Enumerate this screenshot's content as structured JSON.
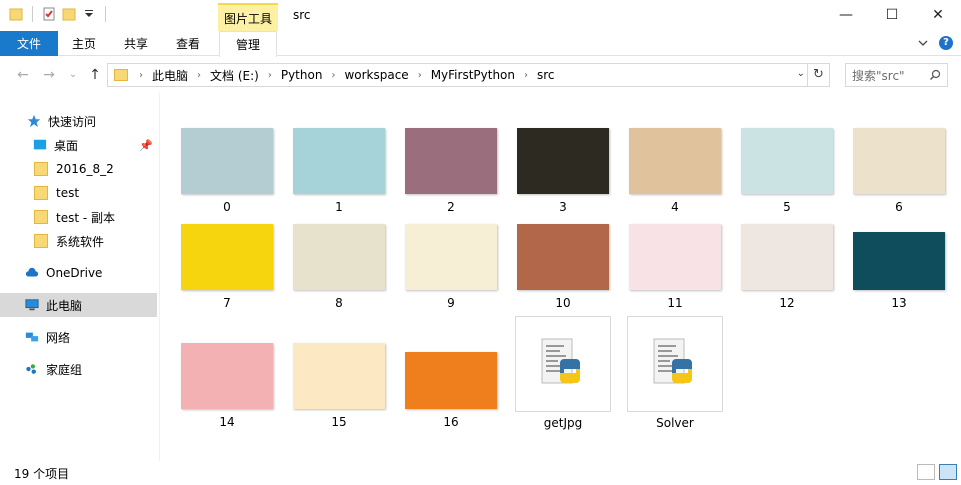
{
  "window": {
    "context_tab_header": "图片工具",
    "title": "src",
    "controls": [
      "—",
      "☐",
      "✕"
    ]
  },
  "ribbon": {
    "tabs": [
      "文件",
      "主页",
      "共享",
      "查看",
      "管理"
    ]
  },
  "address": {
    "crumbs": [
      "此电脑",
      "文档 (E:)",
      "Python",
      "workspace",
      "MyFirstPython",
      "src"
    ],
    "search_placeholder": "搜索\"src\""
  },
  "sidebar": {
    "items": [
      {
        "label": "快速访问",
        "icon": "star-icon"
      },
      {
        "label": "桌面",
        "icon": "desktop-icon",
        "pinned": true
      },
      {
        "label": "2016_8_2",
        "icon": "folder-icon"
      },
      {
        "label": "test",
        "icon": "folder-icon"
      },
      {
        "label": "test - 副本",
        "icon": "folder-icon"
      },
      {
        "label": "系统软件",
        "icon": "folder-icon"
      },
      {
        "label": "OneDrive",
        "icon": "cloud-icon"
      },
      {
        "label": "此电脑",
        "icon": "computer-icon",
        "selected": true
      },
      {
        "label": "网络",
        "icon": "network-icon"
      },
      {
        "label": "家庭组",
        "icon": "homegroup-icon"
      }
    ]
  },
  "files": [
    {
      "name": "0",
      "bg": "#b3cdd2"
    },
    {
      "name": "1",
      "bg": "#a5d3d9"
    },
    {
      "name": "2",
      "bg": "#9a6e7c"
    },
    {
      "name": "3",
      "bg": "#2d2a22"
    },
    {
      "name": "4",
      "bg": "#e0c29c"
    },
    {
      "name": "5",
      "bg": "#cbe3e3"
    },
    {
      "name": "6",
      "bg": "#ece2cb"
    },
    {
      "name": "7",
      "bg": "#f6d40e"
    },
    {
      "name": "8",
      "bg": "#e7e2cc"
    },
    {
      "name": "9",
      "bg": "#f6eed5"
    },
    {
      "name": "10",
      "bg": "#b2664a"
    },
    {
      "name": "11",
      "bg": "#f8e2e6"
    },
    {
      "name": "12",
      "bg": "#ede6e1"
    },
    {
      "name": "13",
      "bg": "#0f4c5c"
    },
    {
      "name": "14",
      "bg": "#f4b1b4"
    },
    {
      "name": "15",
      "bg": "#fde8c4"
    },
    {
      "name": "16",
      "bg": "#ef7f1d"
    }
  ],
  "scripts": [
    {
      "name": "getJpg"
    },
    {
      "name": "Solver"
    }
  ],
  "status": {
    "count": "19 个项目"
  }
}
